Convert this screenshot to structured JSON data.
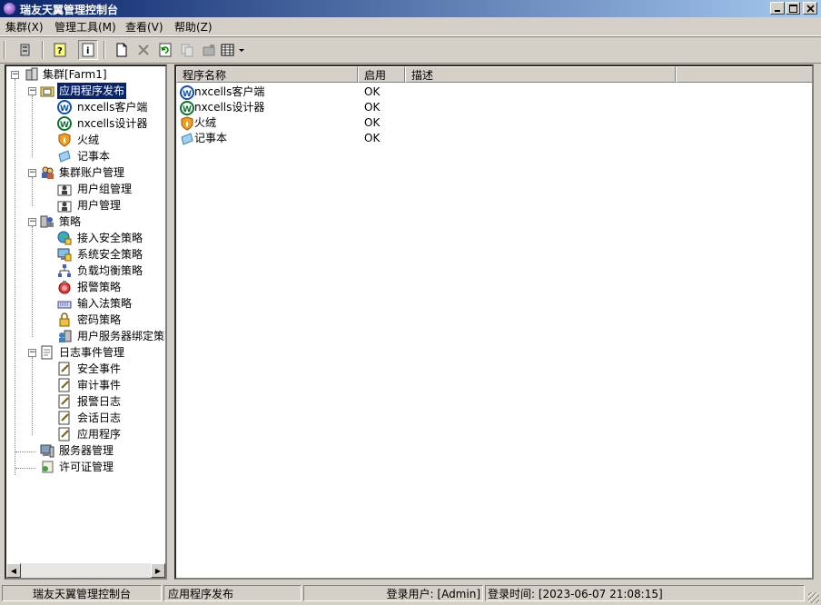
{
  "window": {
    "title": "瑞友天翼管理控制台"
  },
  "menu": [
    "集群(X)",
    "管理工具(M)",
    "查看(V)",
    "帮助(Z)"
  ],
  "tree": {
    "root": "集群[Farm1]",
    "nodes": [
      {
        "label": "应用程序发布",
        "selected": true
      },
      {
        "label": "nxcells客户端"
      },
      {
        "label": "nxcells设计器"
      },
      {
        "label": "火绒"
      },
      {
        "label": "记事本"
      },
      {
        "label": "集群账户管理"
      },
      {
        "label": "用户组管理"
      },
      {
        "label": "用户管理"
      },
      {
        "label": "策略"
      },
      {
        "label": "接入安全策略"
      },
      {
        "label": "系统安全策略"
      },
      {
        "label": "负载均衡策略"
      },
      {
        "label": "报警策略"
      },
      {
        "label": "输入法策略"
      },
      {
        "label": "密码策略"
      },
      {
        "label": "用户服务器绑定策略"
      },
      {
        "label": "日志事件管理"
      },
      {
        "label": "安全事件"
      },
      {
        "label": "审计事件"
      },
      {
        "label": "报警日志"
      },
      {
        "label": "会话日志"
      },
      {
        "label": "应用程序"
      },
      {
        "label": "服务器管理"
      },
      {
        "label": "许可证管理"
      }
    ]
  },
  "list": {
    "columns": [
      "程序名称",
      "启用",
      "描述"
    ],
    "rows": [
      {
        "name": "nxcells客户端",
        "enabled": "OK",
        "description": ""
      },
      {
        "name": "nxcells设计器",
        "enabled": "OK",
        "description": ""
      },
      {
        "name": "火绒",
        "enabled": "OK",
        "description": ""
      },
      {
        "name": "记事本",
        "enabled": "OK",
        "description": ""
      }
    ]
  },
  "status": {
    "app": "瑞友天翼管理控制台",
    "section": "应用程序发布",
    "user_label": "登录用户: [Admin]",
    "time_label": "登录时间: [2023-06-07 21:08:15]"
  }
}
